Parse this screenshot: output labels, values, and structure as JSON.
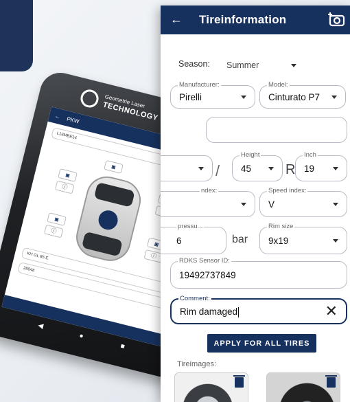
{
  "app": {
    "title": "Tireinformation",
    "back_glyph": "←"
  },
  "form": {
    "season": {
      "label": "Season:",
      "value": "Summer"
    },
    "manufacturer": {
      "label": "Manufacturer:",
      "value": "Pirelli"
    },
    "model": {
      "label": "Model:",
      "value": "Cinturato P7"
    },
    "width_sep": "/",
    "height": {
      "label": "Height",
      "value": "45"
    },
    "r_sep": "R",
    "inch": {
      "label": "Inch",
      "value": "19"
    },
    "load_index": {
      "label": "ndex:",
      "value": ""
    },
    "speed_index": {
      "label": "Speed index:",
      "value": "V"
    },
    "pressure": {
      "label": "pressu...",
      "value": "6",
      "unit": "bar"
    },
    "rim_size": {
      "label": "Rim size",
      "value": "9x19"
    },
    "sensor": {
      "label": "RDKS Sensor ID:",
      "value": "19492737849"
    },
    "comment": {
      "label": "Comment:",
      "value": "Rim damaged"
    },
    "apply_label": "APPLY FOR ALL TIRES",
    "tireimages_label": "Tireimages:"
  },
  "phone": {
    "brand_line1": "Geometrie Laser",
    "brand_line2": "TECHNOLOGY",
    "screen_title": "PKW",
    "plate": "L16MBE14",
    "row1": "KH GL 85 E",
    "row2": "28048"
  },
  "colors": {
    "primary": "#17315f",
    "accent_dark": "#1d3359"
  }
}
